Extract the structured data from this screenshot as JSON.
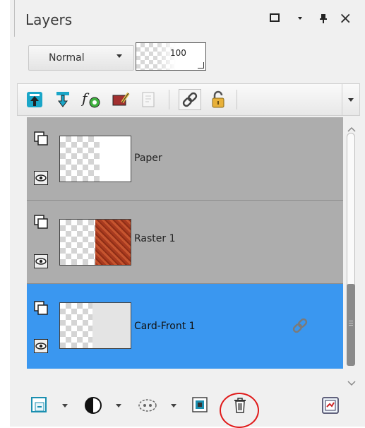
{
  "panel": {
    "title": "Layers",
    "window_buttons": [
      "maximize-icon",
      "dropdown-arrow-icon",
      "pin-icon",
      "close-icon"
    ],
    "close_label": "×"
  },
  "blend_mode": {
    "selected": "Normal"
  },
  "opacity": {
    "value": "100"
  },
  "toolbar": {
    "icons": [
      "move-up-icon",
      "move-down-icon",
      "fx-effects-icon",
      "edit-selection-icon",
      "properties-icon",
      "link-icon",
      "lock-icon"
    ]
  },
  "layers": [
    {
      "name": "Paper",
      "selected": false,
      "linked": false
    },
    {
      "name": "Raster 1",
      "selected": false,
      "linked": false
    },
    {
      "name": "Card-Front 1",
      "selected": true,
      "linked": true
    }
  ],
  "bottom_toolbar": {
    "icons": [
      "new-layer-icon",
      "adjustment-layer-icon",
      "mask-icon",
      "merge-icon",
      "delete-layer-icon",
      "properties-icon"
    ]
  },
  "colors": {
    "selected_row": "#3a97f0",
    "row_bg": "#adadad",
    "highlight_circle": "#e01a1a"
  }
}
